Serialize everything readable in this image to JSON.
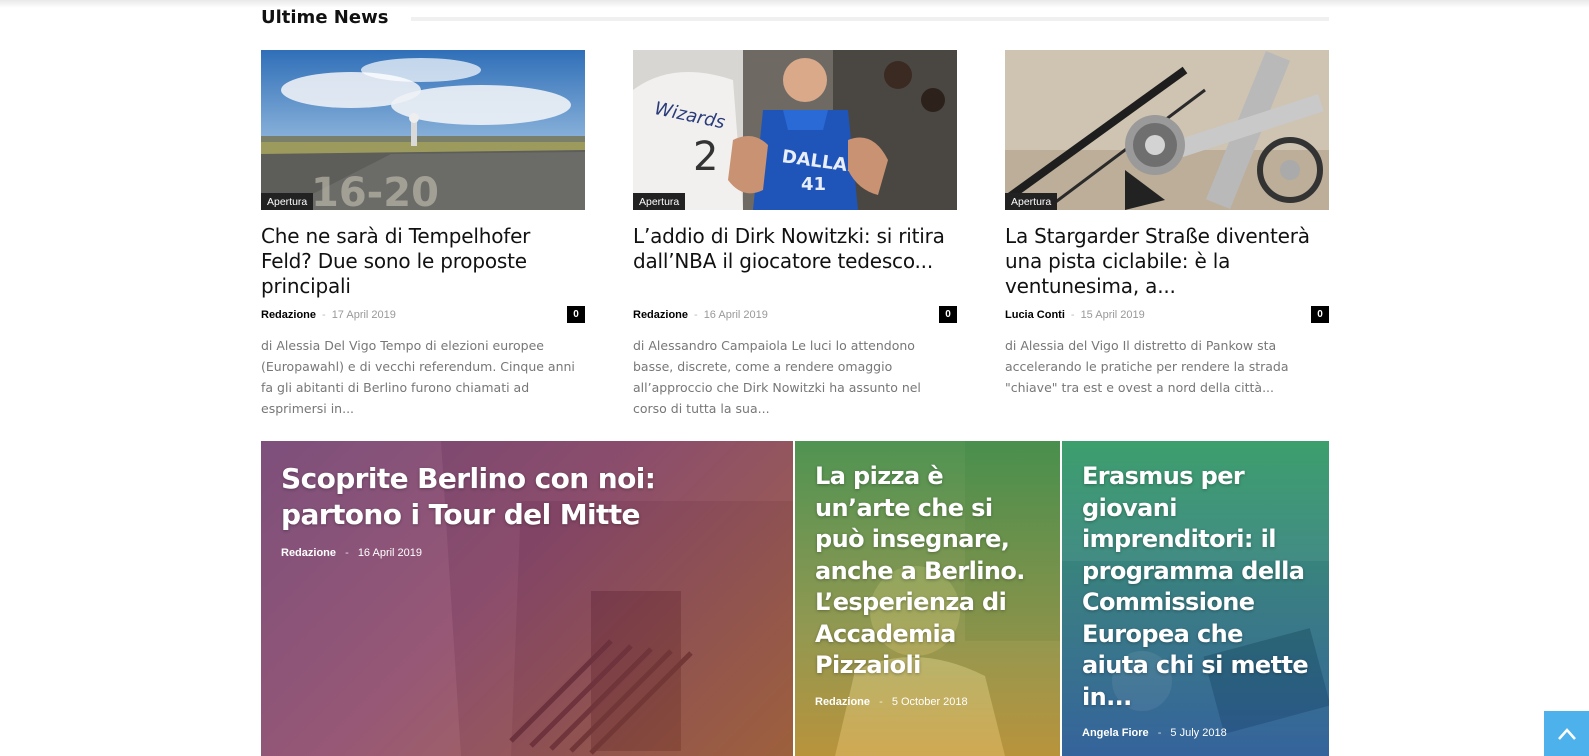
{
  "section": {
    "title": "Ultime News"
  },
  "articles": [
    {
      "category": "Apertura",
      "title": "Che ne sarà di Tempelhofer Feld? Due sono le proposte principali",
      "author": "Redazione",
      "date": "17 April 2019",
      "comments": "0",
      "excerpt": "di Alessia Del Vigo Tempo di elezioni europee (Europawahl) e di vecchi referendum. Cinque anni fa gli abitanti di Berlino furono chiamati ad esprimersi in..."
    },
    {
      "category": "Apertura",
      "title": "L’addio di Dirk Nowitzki: si ritira dall’NBA il giocatore tedesco...",
      "author": "Redazione",
      "date": "16 April 2019",
      "comments": "0",
      "excerpt": "di Alessandro Campaiola Le luci lo attendono basse, discrete, come a rendere omaggio all’approccio che Dirk Nowitzki ha assunto nel corso di tutta la sua..."
    },
    {
      "category": "Apertura",
      "title": "La Stargarder Straße diventerà una pista ciclabile: è la ventunesima, a...",
      "author": "Lucia Conti",
      "date": "15 April 2019",
      "comments": "0",
      "excerpt": "di Alessia del Vigo Il distretto di Pankow sta accelerando le pratiche per rendere la strada \"chiave\" tra est e ovest a nord della città..."
    }
  ],
  "featured": [
    {
      "title": "Scoprite Berlino con noi: partono i Tour del Mitte",
      "author": "Redazione",
      "date": "16 April 2019"
    },
    {
      "title": "La pizza è un’arte che si può insegnare, anche a Berlino. L’esperienza di Accademia Pizzaioli",
      "author": "Redazione",
      "date": "5 October 2018"
    },
    {
      "title": "Erasmus per giovani imprenditori: il programma della Commissione Europea che aiuta chi si mette in...",
      "author": "Angela Fiore",
      "date": "5 July 2018"
    }
  ],
  "icons": {
    "back_to_top": "arrow-up-icon"
  },
  "colors": {
    "accent": "#4db2ec",
    "badge": "#222222"
  }
}
